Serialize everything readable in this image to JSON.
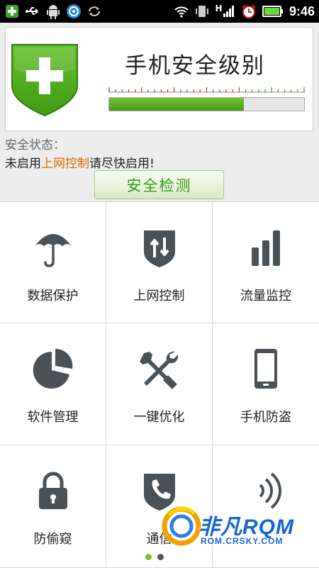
{
  "status_bar": {
    "time": "9:46",
    "network_label": "H",
    "icons": [
      "add-icon",
      "usb-icon",
      "android-icon",
      "browser-icon",
      "sync-icon",
      "wifi-icon",
      "vibrate-icon",
      "signal-icon",
      "alarm-icon",
      "battery-icon"
    ]
  },
  "header": {
    "title": "手机安全级别",
    "level_fraction": 0.69
  },
  "status": {
    "label": "安全状态：",
    "prefix": "未启用",
    "highlight": "上网控制",
    "suffix": "请尽快启用!"
  },
  "check_button": "安全检测",
  "grid": [
    {
      "label": "数据保护",
      "icon": "umbrella-icon"
    },
    {
      "label": "上网控制",
      "icon": "shield-arrows-icon"
    },
    {
      "label": "流量监控",
      "icon": "bar-chart-icon"
    },
    {
      "label": "软件管理",
      "icon": "pie-chart-icon"
    },
    {
      "label": "一键优化",
      "icon": "tools-icon"
    },
    {
      "label": "手机防盗",
      "icon": "phone-icon"
    },
    {
      "label": "防偷窥",
      "icon": "lock-icon"
    },
    {
      "label": "通信",
      "icon": "call-shield-icon"
    },
    {
      "label": "",
      "icon": "signal-waves-icon"
    }
  ],
  "watermark": {
    "brand": "非凡RQM",
    "url": "ROM.CRSKY.COM"
  },
  "pager": {
    "count": 2,
    "active": 0
  },
  "colors": {
    "accent_green": "#4a9c1c",
    "highlight_orange": "#e16b00",
    "icon_gray": "#4a5157"
  }
}
